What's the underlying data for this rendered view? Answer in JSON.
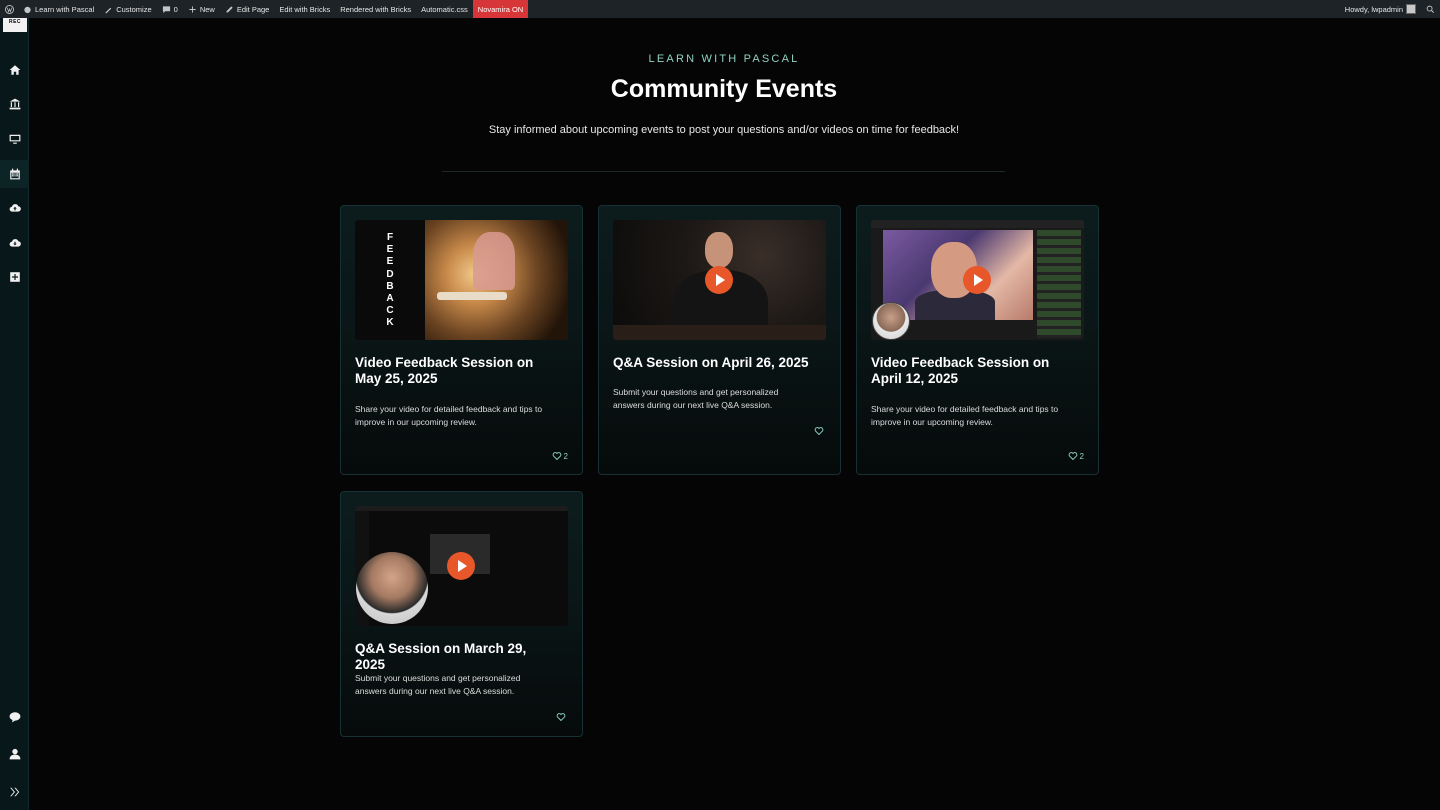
{
  "adminbar": {
    "site_name": "Learn with Pascal",
    "customize": "Customize",
    "comments_count": "0",
    "new": "New",
    "edit_page": "Edit Page",
    "edit_bricks": "Edit with Bricks",
    "rendered": "Rendered with Bricks",
    "automatic": "Automatic.css",
    "novamira": "Novamira ON",
    "howdy": "Howdy, lwpadmin"
  },
  "sidebar": {
    "logo": "REC",
    "top_icons": [
      "home-icon",
      "bank-icon",
      "monitor-icon",
      "calendar-icon",
      "cloud-upload-icon",
      "cloud-download-icon",
      "plus-square-icon"
    ],
    "bottom_icons": [
      "chat-icon",
      "user-icon",
      "expand-icon"
    ]
  },
  "header": {
    "eyebrow": "LEARN WITH PASCAL",
    "title": "Community Events",
    "subtitle": "Stay informed about upcoming events to post your questions and/or videos on time for feedback!"
  },
  "cards": [
    {
      "title": "Video Feedback Session on May 25, 2025",
      "description": "Share your video for detailed feedback and tips to improve in our upcoming review.",
      "likes": "2",
      "thumb_text": "FEEDBACK"
    },
    {
      "title": "Q&A Session on April 26, 2025",
      "description": "Submit your questions and get personalized answers during our next live Q&A session.",
      "likes": ""
    },
    {
      "title": "Video Feedback Session on April 12, 2025",
      "description": "Share your video for detailed feedback and tips to improve in our upcoming review.",
      "likes": "2"
    },
    {
      "title": "Q&A Session on March 29, 2025",
      "description": "Submit your questions and get personalized answers during our next live Q&A session.",
      "likes": ""
    }
  ],
  "colors": {
    "accent": "#8fd3c4",
    "play": "#e8572a",
    "novamira": "#d63638"
  }
}
